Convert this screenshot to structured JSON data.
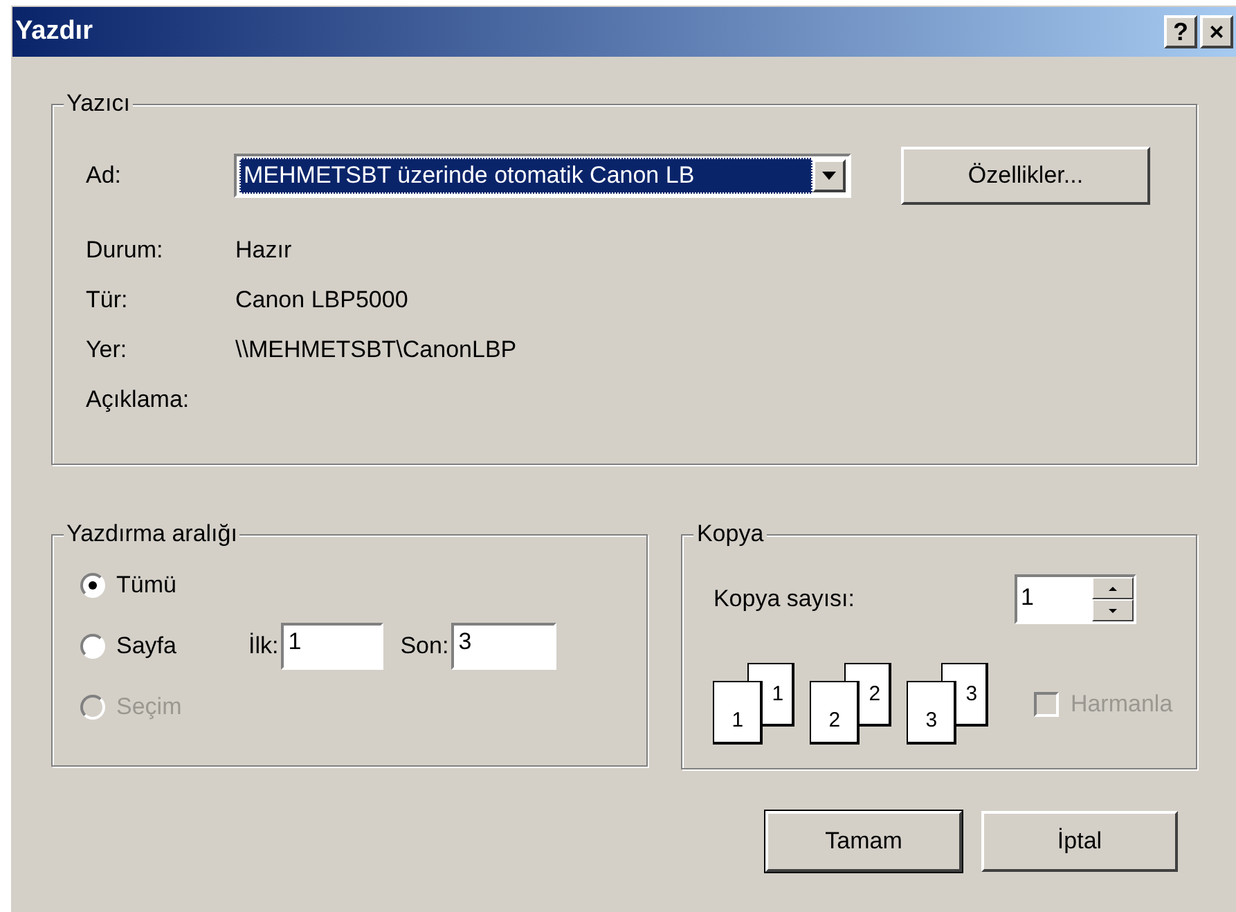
{
  "window": {
    "title": "Yazdır",
    "title_buttons": [
      "?",
      "×"
    ]
  },
  "printer": {
    "title": "Yazıcı",
    "name_label": "Ad:",
    "name_value": "MEHMETSBT üzerinde otomatik Canon LB",
    "properties_button": "Özellikler...",
    "details": [
      {
        "label": "Durum:",
        "value": "Hazır"
      },
      {
        "label": "Tür:",
        "value": "Canon LBP5000"
      },
      {
        "label": "Yer:",
        "value": "\\\\MEHMETSBT\\CanonLBP"
      },
      {
        "label": "Açıklama:"
      }
    ]
  },
  "range": {
    "title": "Yazdırma aralığı",
    "options": [
      {
        "label": "Tümü",
        "selected": true,
        "disabled": false
      },
      {
        "label": "Sayfa",
        "selected": false,
        "disabled": false
      },
      {
        "label": "Seçim",
        "selected": false,
        "disabled": true
      }
    ],
    "from_label": "İlk:",
    "from_value": "1",
    "to_label": "Son:",
    "to_value": "3"
  },
  "copies": {
    "title": "Kopya",
    "count_label": "Kopya sayısı:",
    "count_value": "1",
    "collate_pages": [
      [
        "1",
        "1"
      ],
      [
        "2",
        "2"
      ],
      [
        "3",
        "3"
      ]
    ],
    "collate": {
      "label": "Harmanla",
      "checked": false,
      "disabled": true
    }
  },
  "buttons": [
    {
      "label": "Tamam",
      "default": true
    },
    {
      "label": "İptal",
      "default": false
    }
  ]
}
